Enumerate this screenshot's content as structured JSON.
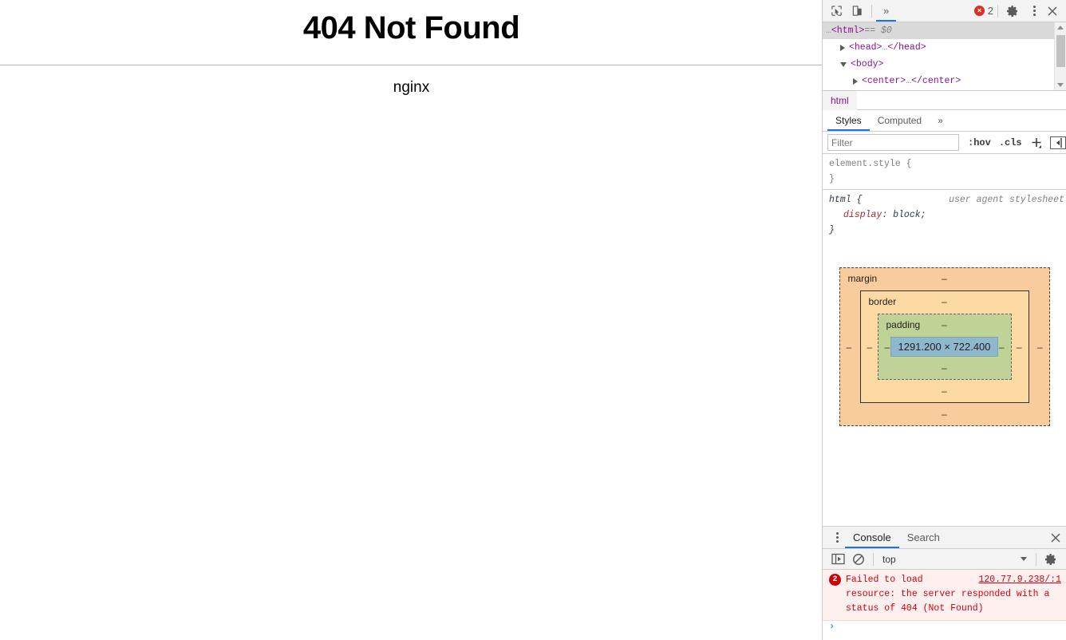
{
  "page": {
    "heading": "404 Not Found",
    "server": "nginx"
  },
  "devtools": {
    "toolbar": {
      "inspect_icon": "inspect-element-icon",
      "device_icon": "device-toolbar-icon",
      "more_tabs": "»",
      "error_count": "2",
      "error_badge": "×",
      "settings_icon": "gear-icon",
      "menu_icon": "kebab-menu-icon",
      "close_icon": "close-icon"
    },
    "dom_tree": {
      "rows": [
        {
          "prefix": "…",
          "open": "<html>",
          "suffix": " == $0",
          "selected": true
        },
        {
          "prefix": "",
          "open": "<head>",
          "ellipsis": "…",
          "close": "</head>",
          "indent": 1
        },
        {
          "prefix": "",
          "open": "<body>",
          "indent": 1
        },
        {
          "prefix": "",
          "open": "<center>",
          "ellipsis": "…",
          "close": "</center>",
          "indent": 2
        }
      ]
    },
    "breadcrumb": {
      "items": [
        "html"
      ]
    },
    "styles_tabs": {
      "tabs": [
        "Styles",
        "Computed"
      ],
      "active": "Styles",
      "overflow": "»"
    },
    "filter_bar": {
      "placeholder": "Filter",
      "value": "",
      "hov": ":hov",
      "cls": ".cls",
      "new_rule": "+",
      "sidebar_toggle": "toggle-sidebar-icon"
    },
    "rules": [
      {
        "selector": "element.style {",
        "source": "",
        "declarations": [],
        "close": "}"
      },
      {
        "selector": "html {",
        "source": "user agent stylesheet",
        "declarations": [
          {
            "name": "display",
            "value": "block;"
          }
        ],
        "close": "}"
      }
    ],
    "box_model": {
      "margin_label": "margin",
      "border_label": "border",
      "padding_label": "padding",
      "content_size": "1291.200 × 722.400",
      "dash": "–",
      "colors": {
        "margin": "#f9cc9d",
        "border": "#fdd9a3",
        "padding": "#c0d397",
        "content": "#8fb8cc"
      }
    },
    "drawer": {
      "menu_icon": "kebab-menu-icon",
      "tabs": [
        "Console",
        "Search"
      ],
      "active_tab": "Console",
      "close_icon": "close-icon",
      "console_toolbar": {
        "sidebar_icon": "console-sidebar-icon",
        "clear_icon": "clear-console-icon",
        "context": "top",
        "settings_icon": "gear-icon"
      },
      "messages": [
        {
          "count": "2",
          "text": "Failed to load resource: the server responded with a status of 404 (Not Found)",
          "link": "120.77.9.238/:1"
        }
      ],
      "prompt": "›"
    }
  },
  "colors": {
    "accent": "#1a73e8",
    "error": "#d93025",
    "toolbar_bg": "#f3f3f3",
    "border": "#cdcdcd"
  }
}
